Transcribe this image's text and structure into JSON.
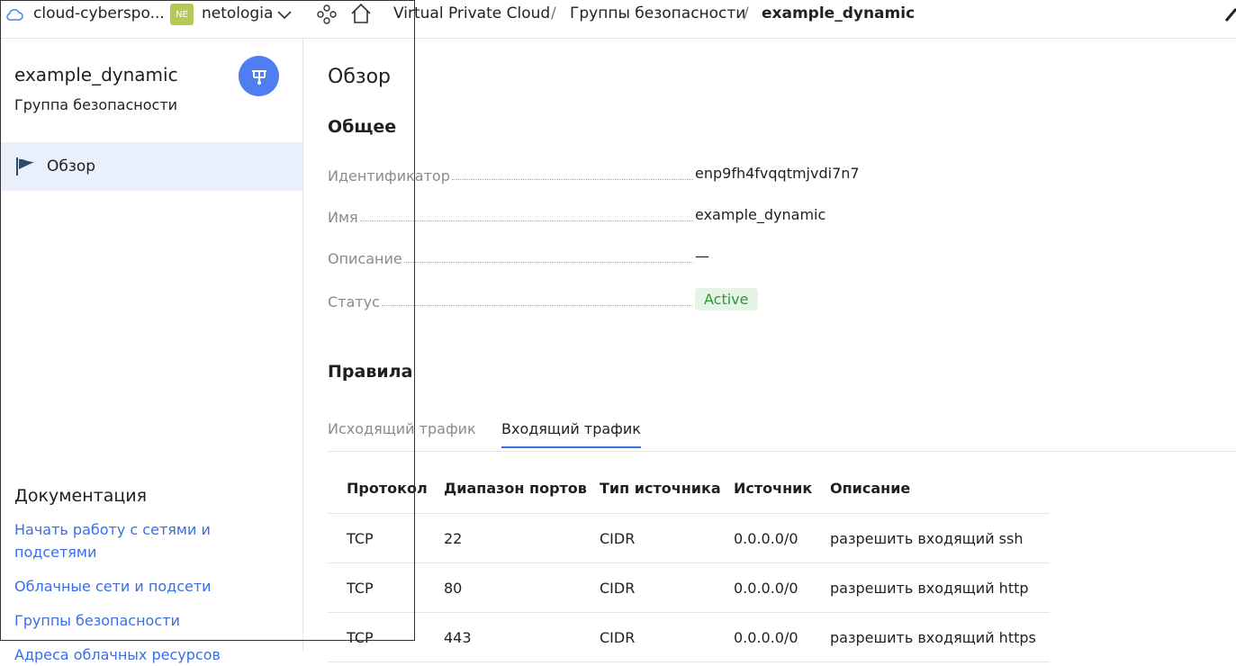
{
  "topbar": {
    "cloud_name": "cloud-cyberspo...",
    "folder_badge": "NE",
    "folder_name": "netologia",
    "breadcrumbs": [
      "Virtual Private Cloud",
      "Группы безопасности",
      "example_dynamic"
    ],
    "separator": "/"
  },
  "sidebar": {
    "title": "example_dynamic",
    "subtitle": "Группа безопасности",
    "nav_items": [
      {
        "label": "Обзор",
        "icon": "flag-icon"
      }
    ],
    "docs_title": "Документация",
    "doc_links": [
      "Начать работу с сетями и подсетями",
      "Облачные сети и подсети",
      "Группы безопасности",
      "Адреса облачных ресурсов"
    ]
  },
  "main": {
    "heading": "Обзор",
    "general_heading": "Общее",
    "properties": [
      {
        "label": "Идентификатор",
        "value": "enp9fh4fvqqtmjvdi7n7"
      },
      {
        "label": "Имя",
        "value": "example_dynamic"
      },
      {
        "label": "Описание",
        "value": "—"
      },
      {
        "label": "Статус",
        "value": "Active"
      }
    ],
    "rules_heading": "Правила",
    "tabs": [
      {
        "label": "Исходящий трафик",
        "active": false
      },
      {
        "label": "Входящий трафик",
        "active": true
      }
    ],
    "table": {
      "columns": [
        "Протокол",
        "Диапазон портов",
        "Тип источника",
        "Источник",
        "Описание"
      ],
      "rows": [
        [
          "TCP",
          "22",
          "CIDR",
          "0.0.0.0/0",
          "разрешить входящий ssh"
        ],
        [
          "TCP",
          "80",
          "CIDR",
          "0.0.0.0/0",
          "разрешить входящий http"
        ],
        [
          "TCP",
          "443",
          "CIDR",
          "0.0.0.0/0",
          "разрешить входящий https"
        ]
      ]
    }
  },
  "colors": {
    "accent": "#3a6ee6",
    "active_status": "#2b9a2e",
    "folder_badge": "#b5c957",
    "nav_active_bg": "#e9effb"
  }
}
